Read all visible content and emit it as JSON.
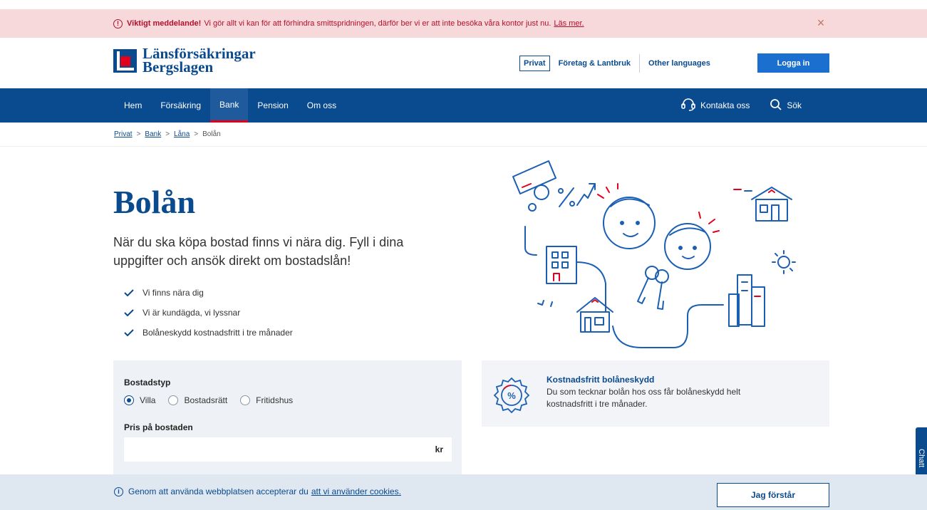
{
  "alert": {
    "icon": "info-icon",
    "strong": "Viktigt meddelande!",
    "text": "Vi gör allt vi kan för att förhindra smittspridningen, därför ber vi er att inte besöka våra kontor just nu.",
    "link": "Läs mer.",
    "close_icon": "close-icon"
  },
  "header": {
    "logo_line1": "Länsförsäkringar",
    "logo_line2": "Bergslagen",
    "links": {
      "privat": "Privat",
      "foretag": "Företag & Lantbruk",
      "languages": "Other languages"
    },
    "login": "Logga in"
  },
  "nav": {
    "items": [
      {
        "label": "Hem"
      },
      {
        "label": "Försäkring"
      },
      {
        "label": "Bank"
      },
      {
        "label": "Pension"
      },
      {
        "label": "Om oss"
      }
    ],
    "active": "Bank",
    "contact": "Kontakta oss",
    "search": "Sök"
  },
  "breadcrumb": {
    "items": [
      "Privat",
      "Bank",
      "Låna"
    ],
    "current": "Bolån",
    "separator": ">"
  },
  "hero": {
    "title": "Bolån",
    "lead": "När du ska köpa bostad finns vi nära dig. Fyll i dina uppgifter och ansök direkt om bostadslån!",
    "checks": [
      "Vi finns nära dig",
      "Vi är kundägda, vi lyssnar",
      "Bolåneskydd kostnadsfritt i tre månader"
    ]
  },
  "form": {
    "type_label": "Bostadstyp",
    "options": [
      "Villa",
      "Bostadsrätt",
      "Fritidshus"
    ],
    "selected": "Villa",
    "price_label": "Pris på bostaden",
    "price_value": "",
    "price_unit": "kr"
  },
  "info": {
    "icon": "percent-badge-icon",
    "title": "Kostnadsfritt bolåneskydd",
    "text": "Du som tecknar bolån hos oss får bolåneskydd helt kostnadsfritt i tre månader."
  },
  "chat": {
    "label": "Chatt"
  },
  "cookie": {
    "text": "Genom att använda webbplatsen accepterar du",
    "link": "att vi använder cookies.",
    "button": "Jag förstår"
  },
  "colors": {
    "brand_blue": "#0a4a8e",
    "brand_red": "#e3001b",
    "login_blue": "#1a6fcf",
    "alert_bg": "#f7d9dc"
  }
}
